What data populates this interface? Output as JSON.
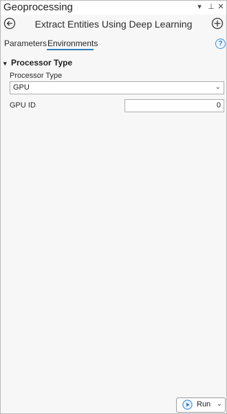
{
  "pane": {
    "title": "Geoprocessing",
    "controls": {
      "menu_glyph": "▾",
      "pin_glyph": "⊥",
      "close_glyph": "✕"
    }
  },
  "tool": {
    "title": "Extract Entities Using Deep Learning",
    "back_icon": "back-arrow-icon",
    "add_icon": "add-circle-icon"
  },
  "tabs": [
    {
      "label": "Parameters",
      "active": false
    },
    {
      "label": "Environments",
      "active": true
    }
  ],
  "help": {
    "glyph": "?"
  },
  "section": {
    "title": "Processor Type",
    "chevron": "▾",
    "fields": {
      "processor_type": {
        "label": "Processor Type",
        "value": "GPU",
        "caret": "⌄"
      },
      "gpu_id": {
        "label": "GPU ID",
        "value": "0"
      }
    }
  },
  "run": {
    "label": "Run",
    "caret": "⌄"
  },
  "colors": {
    "accent": "#2d7fc1",
    "pane_bg": "#f7f7f7",
    "border": "#adadad"
  }
}
